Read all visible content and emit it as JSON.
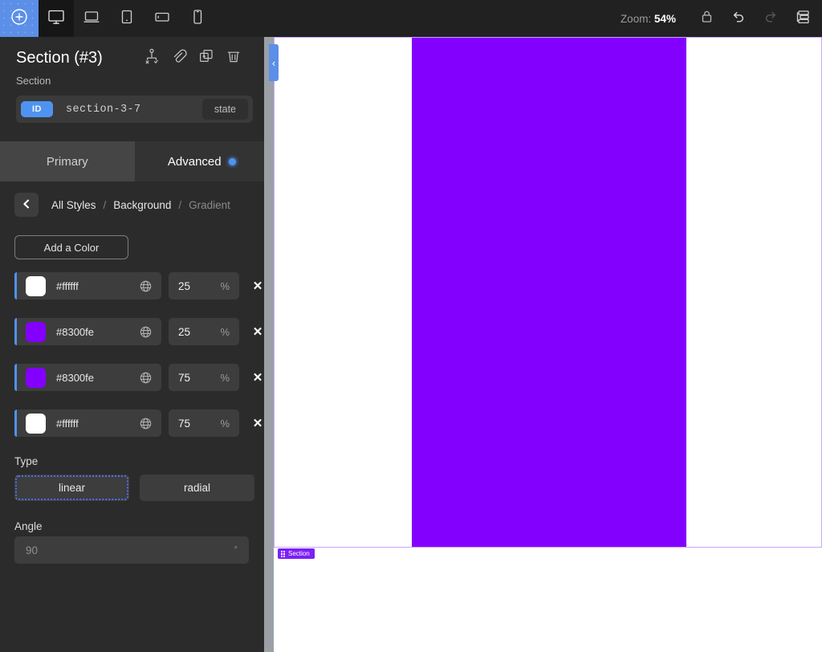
{
  "toolbar": {
    "add_button": "add-circle-icon",
    "devices": [
      {
        "name": "desktop",
        "icon": "desktop-icon",
        "active": true
      },
      {
        "name": "laptop",
        "icon": "laptop-icon",
        "active": false
      },
      {
        "name": "tablet-portrait",
        "icon": "tablet-portrait-icon",
        "active": false
      },
      {
        "name": "tablet-landscape",
        "icon": "tablet-landscape-icon",
        "active": false
      },
      {
        "name": "mobile",
        "icon": "mobile-icon",
        "active": false
      }
    ],
    "zoom_prefix": "Zoom:",
    "zoom_value": "54%",
    "lock_icon": "lock-icon",
    "undo_icon": "undo-icon",
    "redo_icon": "redo-icon",
    "layers_icon": "layers-tree-icon"
  },
  "sidebar": {
    "title": "Section (#3)",
    "subtitle": "Section",
    "actions": [
      {
        "name": "move-to-icon"
      },
      {
        "name": "link-icon"
      },
      {
        "name": "duplicate-icon"
      },
      {
        "name": "delete-icon"
      }
    ],
    "id_row": {
      "badge": "ID",
      "value": "section-3-7",
      "state_label": "state"
    },
    "tabs": [
      {
        "label": "Primary",
        "active": false
      },
      {
        "label": "Advanced",
        "active": true
      }
    ],
    "breadcrumb": {
      "back": "chevron-left-icon",
      "items": [
        "All Styles",
        "Background",
        "Gradient"
      ],
      "separator": "/"
    },
    "add_color_label": "Add a Color",
    "colors": [
      {
        "hex": "#ffffff",
        "swatch": "#ffffff",
        "stop": "25",
        "unit": "%",
        "globe": "globe-icon",
        "remove": "✕"
      },
      {
        "hex": "#8300fe",
        "swatch": "#8300fe",
        "stop": "25",
        "unit": "%",
        "globe": "globe-icon",
        "remove": "✕"
      },
      {
        "hex": "#8300fe",
        "swatch": "#8300fe",
        "stop": "75",
        "unit": "%",
        "globe": "globe-icon",
        "remove": "✕"
      },
      {
        "hex": "#ffffff",
        "swatch": "#ffffff",
        "stop": "75",
        "unit": "%",
        "globe": "globe-icon",
        "remove": "✕"
      }
    ],
    "type": {
      "label": "Type",
      "options": [
        {
          "label": "linear",
          "selected": true
        },
        {
          "label": "radial",
          "selected": false
        }
      ]
    },
    "angle": {
      "label": "Angle",
      "placeholder": "90",
      "value": "",
      "unit": "°"
    }
  },
  "canvas": {
    "collapse_handle": "‹",
    "section_badge": "Section",
    "gradient_color": "#8300fe",
    "page_background": "#ffffff",
    "outline_color": "#c9a6ff"
  },
  "theme": {
    "accent_blue": "#4f93f0",
    "purple": "#8300fe",
    "toolbar_bg": "#212121",
    "panel_bg": "#2b2b2b",
    "field_bg": "#3d3d3d"
  }
}
